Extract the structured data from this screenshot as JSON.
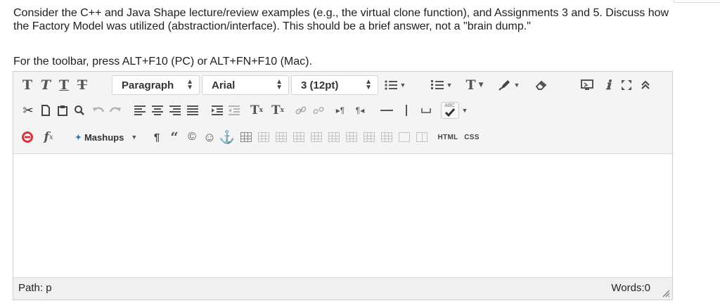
{
  "question": {
    "text": "Consider the C++ and Java Shape lecture/review examples (e.g., the virtual clone function), and Assignments 3 and 5. Discuss how the Factory Model was utilized (abstraction/interface). This should be a brief answer, not a \"brain dump.\""
  },
  "instructions": "For the toolbar, press ALT+F10 (PC) or ALT+FN+F10 (Mac).",
  "toolbar": {
    "row1": {
      "bold": "T",
      "italic": "T",
      "underline": "T",
      "strike": "T",
      "format_select": "Paragraph",
      "font_select": "Arial",
      "size_select": "3 (12pt)",
      "text_color": "T"
    },
    "row2": {
      "superscript": "T",
      "superscript_mark": "x",
      "subscript": "T",
      "subscript_mark": "x",
      "spell_label": "ABC"
    },
    "row3": {
      "formula": "f",
      "formula_sub": "x",
      "mashups": "Mashups",
      "html": "HTML",
      "css": "CSS"
    }
  },
  "statusbar": {
    "path": "Path: p",
    "words": "Words:0"
  }
}
